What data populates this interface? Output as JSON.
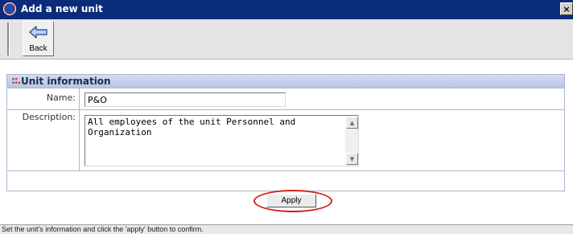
{
  "window": {
    "title": "Add a new unit",
    "close_glyph": "×"
  },
  "toolbar": {
    "back_label": "Back"
  },
  "panel": {
    "title": "Unit information",
    "title_marker": "::.",
    "name_label": "Name:",
    "name_value": "P&O",
    "description_label": "Description:",
    "description_value": "All employees of the unit Personnel and Organization"
  },
  "actions": {
    "apply_label": "Apply"
  },
  "status": {
    "text": "Set the unit's information and click the 'apply' button to confirm."
  },
  "colors": {
    "titlebar": "#0b2c7a",
    "panel_header": "#c8d4ec",
    "highlight": "#d4211e"
  },
  "icons": {
    "back": "back-arrow-icon",
    "app": "app-logo-icon",
    "close": "close-icon"
  }
}
